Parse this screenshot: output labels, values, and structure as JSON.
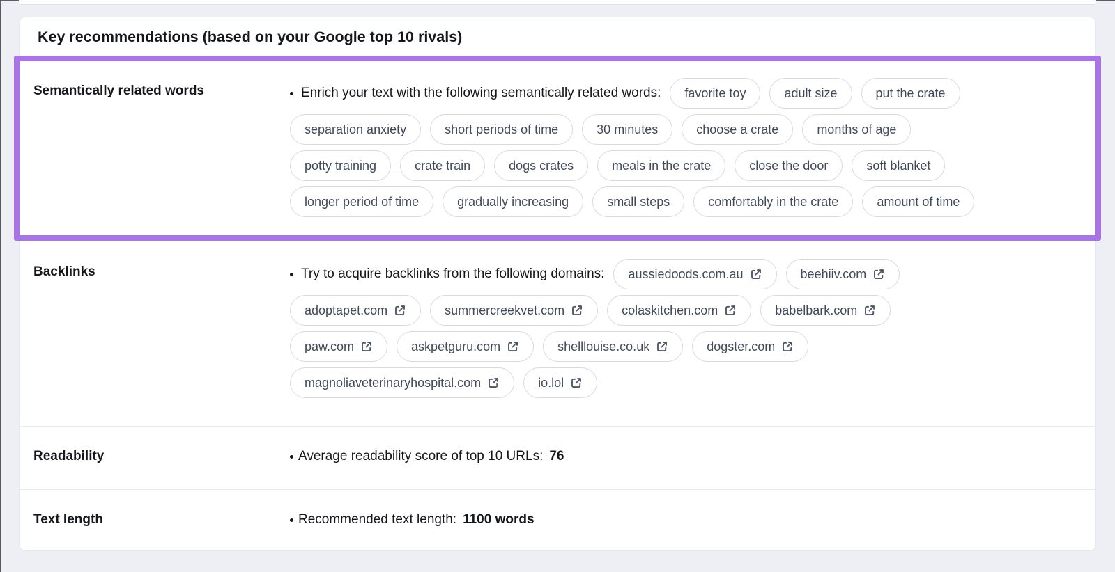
{
  "title": "Key recommendations (based on your Google top 10 rivals)",
  "colors": {
    "highlight": "#ab74e6",
    "pill_border": "#d7dae5",
    "pill_text": "#424a5a",
    "text": "#15171c"
  },
  "sections": {
    "semantic": {
      "label": "Semantically related words",
      "intro": "Enrich your text with the following semantically related words:",
      "word_rows": [
        [
          "favorite toy",
          "adult size",
          "put the crate"
        ],
        [
          "separation anxiety",
          "short periods of time",
          "30 minutes",
          "choose a crate",
          "months of age"
        ],
        [
          "potty training",
          "crate train",
          "dogs crates",
          "meals in the crate",
          "close the door",
          "soft blanket"
        ],
        [
          "longer period of time",
          "gradually increasing",
          "small steps",
          "comfortably in the crate",
          "amount of time"
        ]
      ]
    },
    "backlinks": {
      "label": "Backlinks",
      "intro": "Try to acquire backlinks from the following domains:",
      "domain_rows": [
        [
          "aussiedoods.com.au",
          "beehiiv.com"
        ],
        [
          "adoptapet.com",
          "summercreekvet.com",
          "colaskitchen.com",
          "babelbark.com"
        ],
        [
          "paw.com",
          "askpetguru.com",
          "shelllouise.co.uk",
          "dogster.com"
        ],
        [
          "magnoliaveterinaryhospital.com",
          "io.lol"
        ]
      ]
    },
    "readability": {
      "label": "Readability",
      "intro": "Average readability score of top 10 URLs:",
      "value": "76"
    },
    "text_length": {
      "label": "Text length",
      "intro": "Recommended text length:",
      "value": "1100 words"
    }
  }
}
